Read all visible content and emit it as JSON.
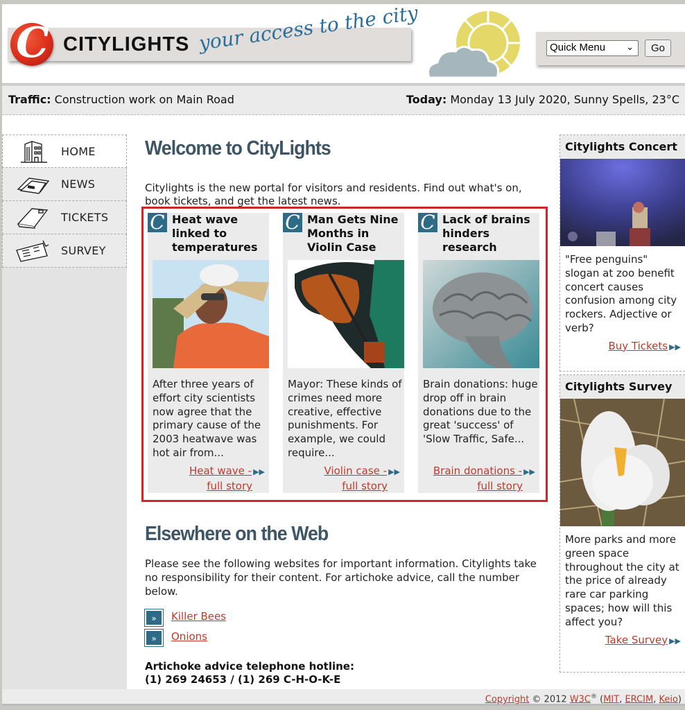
{
  "header": {
    "logo_letter": "C",
    "logo_text": "CITYLIGHTS",
    "tagline": "your access to the city",
    "weather_icon": "sun-behind-cloud-icon",
    "quick_menu": {
      "selected": "Quick Menu",
      "go_label": "Go"
    }
  },
  "infobar": {
    "traffic_label": "Traffic:",
    "traffic_value": "Construction work on Main Road",
    "today_label": "Today:",
    "today_value": "Monday 13 July 2020, Sunny Spells, 23°C"
  },
  "sidebar": {
    "items": [
      {
        "label": "HOME",
        "icon": "building-icon"
      },
      {
        "label": "NEWS",
        "icon": "newspaper-icon"
      },
      {
        "label": "TICKETS",
        "icon": "ticket-icon"
      },
      {
        "label": "SURVEY",
        "icon": "clipboard-icon"
      }
    ]
  },
  "main": {
    "welcome_title": "Welcome to CityLights",
    "intro": "Citylights is the new portal for visitors and residents. Find out what's on, book tickets, and get the latest news.",
    "news": [
      {
        "headline": "Heat wave linked to temperatures",
        "image": "man-with-cardboard-hat-photo",
        "summary": "After three years of effort city scientists now agree that the primary cause of the 2003 heatwave was hot air from...",
        "link_line1": "Heat wave -",
        "link_line2": "full story"
      },
      {
        "headline": "Man Gets Nine Months in Violin Case",
        "image": "violin-in-case-photo",
        "summary": "Mayor: These kinds of crimes need more creative, effective punishments. For example, we could require...",
        "link_line1": "Violin case -",
        "link_line2": "full story"
      },
      {
        "headline": "Lack of brains hinders research",
        "image": "brain-model-photo",
        "summary": "Brain donations: huge drop off in brain donations due to the great 'success' of 'Slow Traffic, Safe...",
        "link_line1": "Brain donations -",
        "link_line2": "full story"
      }
    ],
    "elsewhere_title": "Elsewhere on the Web",
    "elsewhere_text": "Please see the following websites for important information. Citylights take no responsibility for their content. For artichoke advice, call the number below.",
    "external_links": [
      {
        "label": "Killer Bees",
        "icon_text": "»"
      },
      {
        "label": "Onions",
        "icon_text": "»"
      }
    ],
    "hotline_label": "Artichoke advice telephone hotline:",
    "hotline_number": "(1) 269 24653 / (1) 269 C-H-O-K-E"
  },
  "right": {
    "concert": {
      "title": "Citylights Concert",
      "image": "concert-stage-photo",
      "text": "\"Free penguins\" slogan at zoo benefit concert causes confusion among city rockers. Adjective or verb?",
      "link": "Buy Tickets"
    },
    "survey": {
      "title": "Citylights Survey",
      "image": "white-crocus-photo",
      "text": "More parks and more green space throughout the city at the price of already rare car parking spaces; how will this affect you?",
      "link": "Take Survey"
    }
  },
  "footer": {
    "copyright_link": "Copyright",
    "copyright_text": " © 2012 ",
    "w3c": "W3C",
    "reg": "®",
    "open": " (",
    "mit": "MIT",
    "sep1": ", ",
    "ercim": "ERCIM",
    "sep2": ", ",
    "keio": "Keio",
    "close": ")"
  },
  "colors": {
    "accent_red": "#d0232a",
    "link_red": "#c0392b",
    "heading_slate": "#3d5565",
    "icon_teal": "#2d6b87"
  }
}
